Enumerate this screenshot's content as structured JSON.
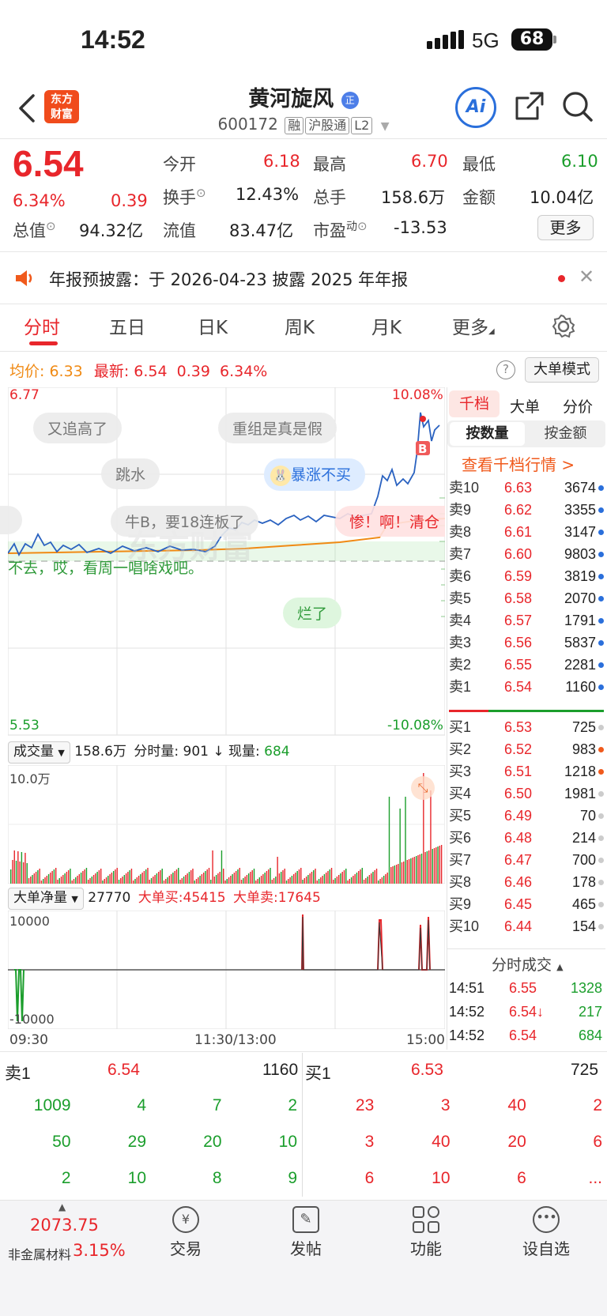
{
  "status_bar": {
    "time": "14:52",
    "network": "5G",
    "battery": "68"
  },
  "header": {
    "title": "黄河旋风",
    "title_badge": "正",
    "code": "600172",
    "tags": [
      "融",
      "沪股通",
      "L2"
    ],
    "logo_line1": "东方",
    "logo_line2": "财富",
    "ai_label": "Ai"
  },
  "quote": {
    "price": "6.54",
    "change_pct": "6.34%",
    "change": "0.39",
    "open_label": "今开",
    "open": "6.18",
    "high_label": "最高",
    "high": "6.70",
    "low_label": "最低",
    "low": "6.10",
    "turnover_label": "换手",
    "turnover": "12.43%",
    "volume_label": "总手",
    "volume": "158.6万",
    "amount_label": "金额",
    "amount": "10.04亿",
    "mktcap_label": "总值",
    "mktcap": "94.32亿",
    "float_label": "流值",
    "float_cap": "83.47亿",
    "pe_label": "市盈",
    "pe_sup": "动",
    "pe": "-13.53",
    "more_label": "更多"
  },
  "notice": {
    "text": "年报预披露：于 2026-04-23 披露 2025 年年报"
  },
  "tabs": [
    "分时",
    "五日",
    "日K",
    "周K",
    "月K",
    "更多"
  ],
  "avg_bar": {
    "avg_label": "均价:",
    "avg": "6.33",
    "latest_label": "最新:",
    "latest": "6.54",
    "change": "0.39",
    "pct": "6.34%",
    "mode_label": "大单模式"
  },
  "chart": {
    "y_top": "6.77",
    "y_bottom": "5.53",
    "pct_top": "10.08%",
    "pct_bottom": "-10.08%",
    "danmu": [
      "又追高了",
      "重组是真是假",
      "跳水",
      "暴涨不买",
      "牛B，要18连板了",
      "惨！啊！清仓",
      "不去，哎，看周一唱啥戏吧。",
      "烂了"
    ],
    "marker": "B",
    "watermark": "东方财富"
  },
  "volume_bar": {
    "dropdown": "成交量",
    "total": "158.6万",
    "tick_label": "分时量:",
    "tick": "901",
    "now_label": "现量:",
    "now": "684",
    "scale": "10.0万"
  },
  "bigorder_bar": {
    "dropdown": "大单净量",
    "value": "27770",
    "buy_label": "大单买:",
    "buy": "45415",
    "sell_label": "大单卖:",
    "sell": "17645",
    "scale_top": "10000",
    "scale_bottom": "-10000"
  },
  "time_axis": [
    "09:30",
    "11:30/13:00",
    "15:00"
  ],
  "orderbook": {
    "tabs": [
      "千档",
      "大单",
      "分价"
    ],
    "subtabs": [
      "按数量",
      "按金额"
    ],
    "link": "查看千档行情 >",
    "asks": [
      {
        "label": "卖10",
        "price": "6.63",
        "vol": "3674"
      },
      {
        "label": "卖9",
        "price": "6.62",
        "vol": "3355"
      },
      {
        "label": "卖8",
        "price": "6.61",
        "vol": "3147"
      },
      {
        "label": "卖7",
        "price": "6.60",
        "vol": "9803"
      },
      {
        "label": "卖6",
        "price": "6.59",
        "vol": "3819"
      },
      {
        "label": "卖5",
        "price": "6.58",
        "vol": "2070"
      },
      {
        "label": "卖4",
        "price": "6.57",
        "vol": "1791"
      },
      {
        "label": "卖3",
        "price": "6.56",
        "vol": "5837"
      },
      {
        "label": "卖2",
        "price": "6.55",
        "vol": "2281"
      },
      {
        "label": "卖1",
        "price": "6.54",
        "vol": "1160"
      }
    ],
    "bids": [
      {
        "label": "买1",
        "price": "6.53",
        "vol": "725"
      },
      {
        "label": "买2",
        "price": "6.52",
        "vol": "983"
      },
      {
        "label": "买3",
        "price": "6.51",
        "vol": "1218"
      },
      {
        "label": "买4",
        "price": "6.50",
        "vol": "1981"
      },
      {
        "label": "买5",
        "price": "6.49",
        "vol": "70"
      },
      {
        "label": "买6",
        "price": "6.48",
        "vol": "214"
      },
      {
        "label": "买7",
        "price": "6.47",
        "vol": "700"
      },
      {
        "label": "买8",
        "price": "6.46",
        "vol": "178"
      },
      {
        "label": "买9",
        "price": "6.45",
        "vol": "465"
      },
      {
        "label": "买10",
        "price": "6.44",
        "vol": "154"
      }
    ],
    "ticks_title": "分时成交",
    "ticks": [
      {
        "time": "14:51",
        "price": "6.55",
        "vol": "1328"
      },
      {
        "time": "14:52",
        "price": "6.54↓",
        "vol": "217"
      },
      {
        "time": "14:52",
        "price": "6.54",
        "vol": "684"
      }
    ]
  },
  "level1": {
    "ask_label": "卖1",
    "ask_price": "6.54",
    "ask_vol": "1160",
    "bid_label": "买1",
    "bid_price": "6.53",
    "bid_vol": "725",
    "ask_queue": [
      [
        "1009",
        "4",
        "7",
        "2"
      ],
      [
        "50",
        "29",
        "20",
        "10"
      ],
      [
        "2",
        "10",
        "8",
        "9"
      ]
    ],
    "bid_queue": [
      [
        "23",
        "3",
        "40",
        "2"
      ],
      [
        "3",
        "40",
        "20",
        "6"
      ],
      [
        "6",
        "10",
        "6",
        "..."
      ]
    ]
  },
  "bottom_nav": {
    "index_value": "2073.75",
    "index_name": "非金属材料",
    "index_pct": "3.15%",
    "items": [
      "交易",
      "发帖",
      "功能",
      "设自选"
    ]
  },
  "colors": {
    "up": "#e8262b",
    "down": "#1b9e2c",
    "accent": "#2a6fdb",
    "avg_line": "#f08a14"
  }
}
